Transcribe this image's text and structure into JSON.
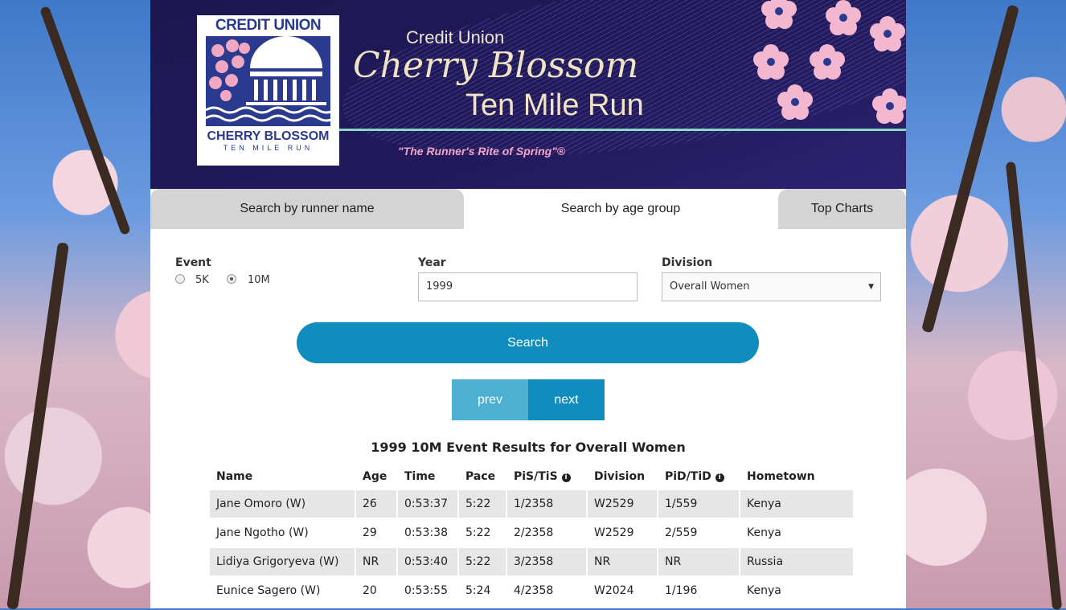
{
  "banner": {
    "logo_line1": "CREDIT UNION",
    "logo_line2": "CHERRY BLOSSOM",
    "logo_line3": "TEN MILE RUN",
    "title_top": "Credit Union",
    "title_script": "Cherry Blossom",
    "title_bottom": "Ten Mile Run",
    "tagline": "\"The Runner's Rite of Spring\"®"
  },
  "tabs": [
    {
      "label": "Search by runner name",
      "active": false
    },
    {
      "label": "Search by age group",
      "active": true
    },
    {
      "label": "Top Charts",
      "active": false
    }
  ],
  "form": {
    "event_label": "Event",
    "event_options": [
      "5K",
      "10M"
    ],
    "event_selected": "10M",
    "year_label": "Year",
    "year_value": "1999",
    "division_label": "Division",
    "division_value": "Overall Women",
    "search_label": "Search"
  },
  "pager": {
    "prev_label": "prev",
    "next_label": "next"
  },
  "results": {
    "title": "1999 10M Event Results for Overall Women",
    "columns": [
      "Name",
      "Age",
      "Time",
      "Pace",
      "PiS/TiS",
      "Division",
      "PiD/TiD",
      "Hometown"
    ],
    "rows": [
      [
        "Jane Omoro (W)",
        "26",
        "0:53:37",
        "5:22",
        "1/2358",
        "W2529",
        "1/559",
        "Kenya"
      ],
      [
        "Jane Ngotho (W)",
        "29",
        "0:53:38",
        "5:22",
        "2/2358",
        "W2529",
        "2/559",
        "Kenya"
      ],
      [
        "Lidiya Grigoryeva (W)",
        "NR",
        "0:53:40",
        "5:22",
        "3/2358",
        "NR",
        "NR",
        "Russia"
      ],
      [
        "Eunice Sagero (W)",
        "20",
        "0:53:55",
        "5:24",
        "4/2358",
        "W2024",
        "1/196",
        "Kenya"
      ]
    ]
  },
  "colors": {
    "banner_bg": "#1c1750",
    "accent_blue": "#0f8dbd",
    "prev_bg": "#4db0d3",
    "tagline_pink": "#f3a3c6"
  }
}
